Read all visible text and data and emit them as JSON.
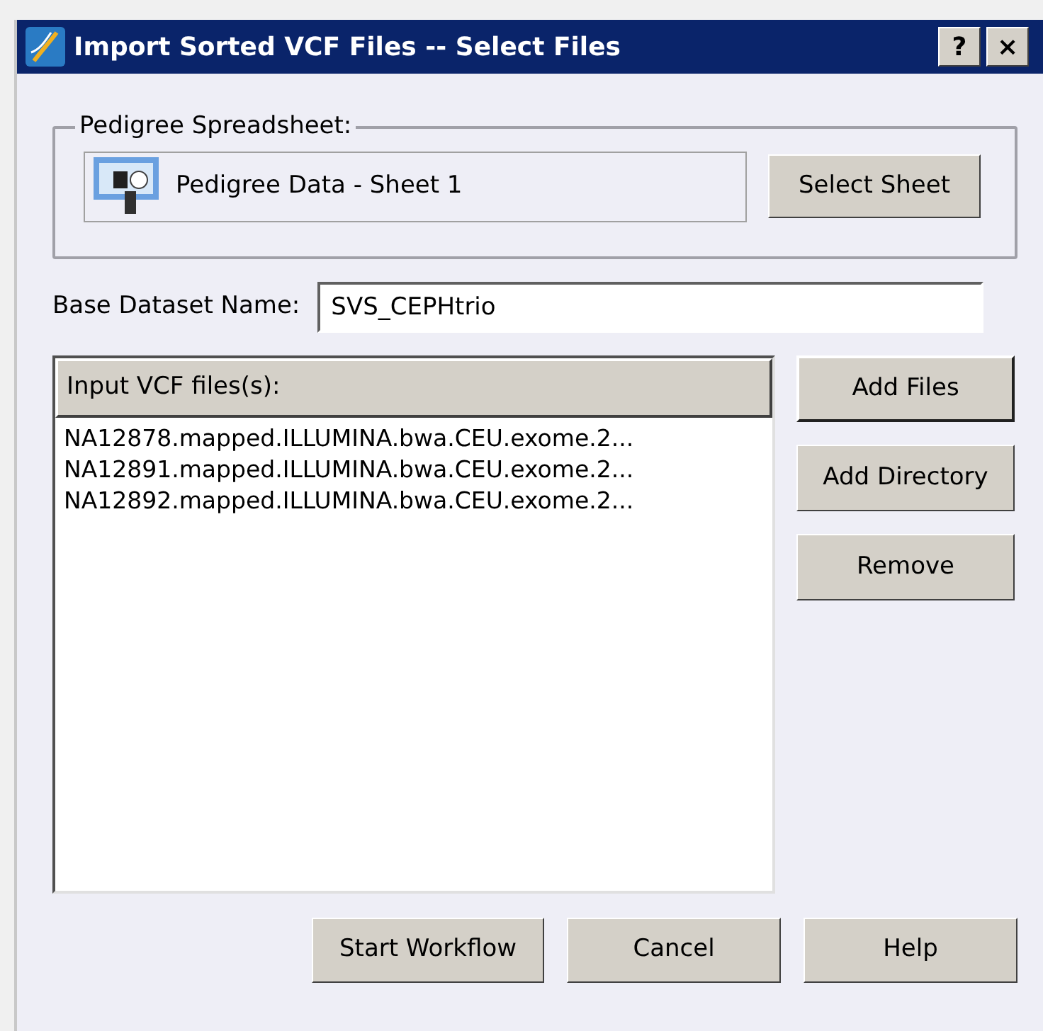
{
  "window": {
    "title": "Import Sorted VCF Files -- Select Files",
    "title_buttons": [
      "?",
      "×"
    ]
  },
  "pedigree_group": {
    "legend": "Pedigree Spreadsheet:",
    "sheet": "Pedigree Data - Sheet 1",
    "button": "Select Sheet"
  },
  "base_dataset": {
    "label": "Base Dataset Name:",
    "value": "SVS_CEPHtrio"
  },
  "files_list": {
    "header": "Input VCF files(s):",
    "items": [
      {
        "text": "NA12878.mapped.ILLUMINA.bwa.CEU.exome.2..."
      },
      {
        "text": "NA12891.mapped.ILLUMINA.bwa.CEU.exome.2..."
      },
      {
        "text": "NA12892.mapped.ILLUMINA.bwa.CEU.exome.2..."
      }
    ]
  },
  "side_buttons": [
    {
      "label": "Add Files",
      "default": true
    },
    {
      "label": "Add Directory",
      "default": false
    },
    {
      "label": "Remove",
      "default": false
    }
  ],
  "bottom_buttons": [
    {
      "label": "Start Workflow"
    },
    {
      "label": "Cancel"
    },
    {
      "label": "Help"
    }
  ]
}
